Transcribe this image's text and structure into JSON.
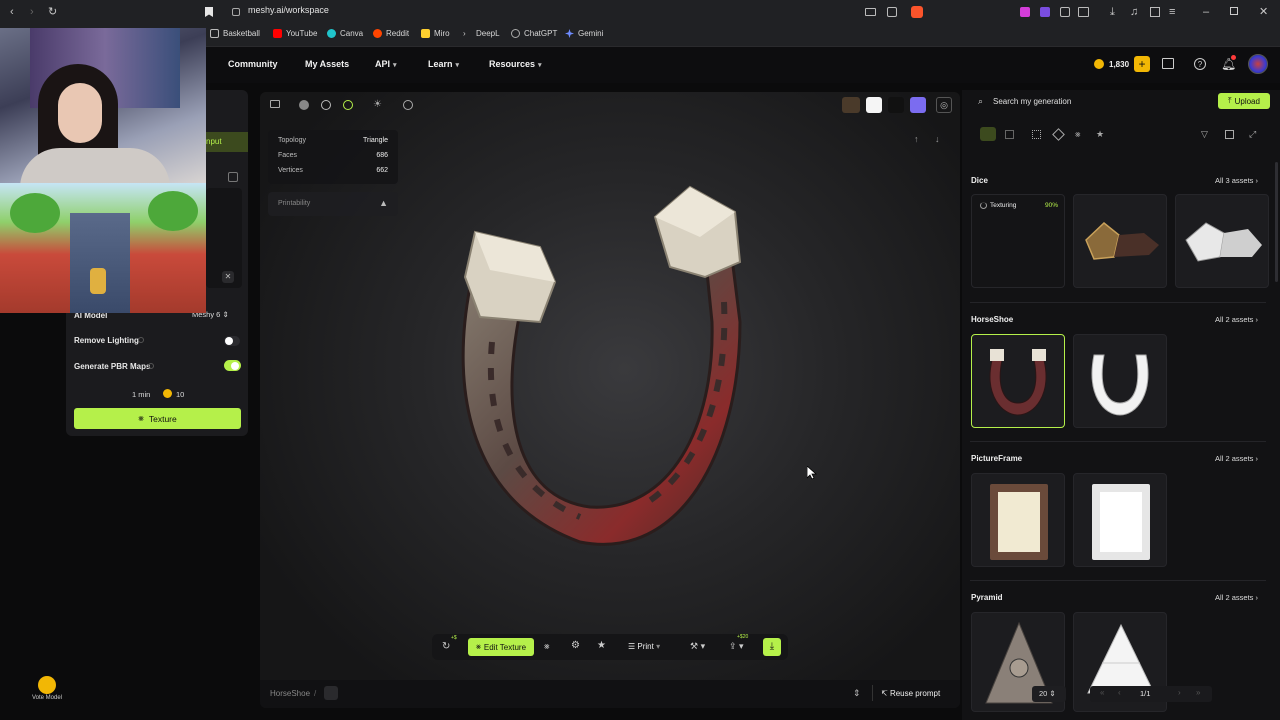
{
  "browser": {
    "url": "meshy.ai/workspace",
    "bookmarks": [
      {
        "label": "Basketball",
        "icon": "folder-icon"
      },
      {
        "label": "YouTube",
        "icon": "youtube-icon",
        "color": "#ff0000"
      },
      {
        "label": "Canva",
        "icon": "canva-icon",
        "color": "#20c4cb"
      },
      {
        "label": "Reddit",
        "icon": "reddit-icon",
        "color": "#ff4500"
      },
      {
        "label": "Miro",
        "icon": "miro-icon",
        "color": "#ffd02f"
      },
      {
        "label": "DeepL",
        "icon": "deepl-icon",
        "color": "#0f2b46"
      },
      {
        "label": "ChatGPT",
        "icon": "chatgpt-icon",
        "color": "#9a9a9a"
      },
      {
        "label": "Gemini",
        "icon": "gemini-icon",
        "color": "#6f8cff"
      }
    ]
  },
  "header": {
    "menu": [
      {
        "label": "Community",
        "dropdown": false
      },
      {
        "label": "My Assets",
        "dropdown": false
      },
      {
        "label": "API",
        "dropdown": true
      },
      {
        "label": "Learn",
        "dropdown": true
      },
      {
        "label": "Resources",
        "dropdown": true
      }
    ],
    "credits": "1,830"
  },
  "left_panel": {
    "input_tab": "nput",
    "ai_model_label": "AI Model",
    "ai_model_value": "Meshy 6",
    "remove_lighting_label": "Remove Lighting",
    "remove_lighting_on": false,
    "pbr_label": "Generate PBR Maps",
    "pbr_on": true,
    "time": "1 min",
    "cost": "10",
    "texture_button": "Texture"
  },
  "sidebar": {
    "vote_label": "Vote Model"
  },
  "viewport": {
    "stats": [
      {
        "label": "Topology",
        "value": "Triangle"
      },
      {
        "label": "Faces",
        "value": "686"
      },
      {
        "label": "Vertices",
        "value": "662"
      }
    ],
    "printability_label": "Printability",
    "tools": {
      "edit_texture": "Edit Texture",
      "print": "Print",
      "badge_new": "+$",
      "badge_price": "+$20"
    },
    "footer": {
      "breadcrumb": "HorseShoe",
      "reuse_prompt": "Reuse prompt"
    }
  },
  "right_panel": {
    "search_placeholder": "Search my generation",
    "upload_label": "Upload",
    "sections": [
      {
        "title": "Dice",
        "all_label": "All 3 assets",
        "status_label": "Texturing",
        "status_pct": "90%"
      },
      {
        "title": "HorseShoe",
        "all_label": "All 2 assets"
      },
      {
        "title": "PictureFrame",
        "all_label": "All 2 assets"
      },
      {
        "title": "Pyramid",
        "all_label": "All 2 assets"
      }
    ],
    "pagination": {
      "per_page": "20",
      "page": "1/1"
    }
  },
  "colors": {
    "accent": "#b5f04a",
    "viewport_bg": "#2a2a2c"
  }
}
